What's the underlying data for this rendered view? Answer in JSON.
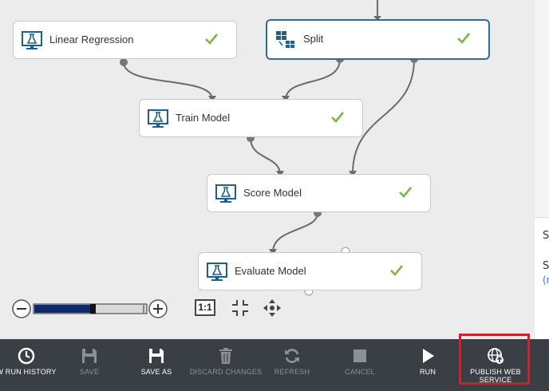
{
  "canvas": {
    "modules": [
      {
        "label": "Linear Regression",
        "type": "train-icon"
      },
      {
        "label": "Split",
        "type": "split-icon"
      },
      {
        "label": "Train Model",
        "type": "train-icon"
      },
      {
        "label": "Score Model",
        "type": "train-icon"
      },
      {
        "label": "Evaluate Model",
        "type": "train-icon"
      }
    ],
    "status": "completed"
  },
  "zoom": {
    "fit_label": "1:1"
  },
  "right_panel": {
    "text1": "S",
    "text2": "S",
    "link": "(r"
  },
  "toolbar": {
    "run_history": "W RUN HISTORY",
    "save": "SAVE",
    "save_as": "SAVE AS",
    "discard": "DISCARD CHANGES",
    "refresh": "REFRESH",
    "cancel": "CANCEL",
    "run": "RUN",
    "publish": "PUBLISH WEB SERVICE"
  },
  "colors": {
    "toolbar_bg": "#3a3f45",
    "accent": "#2a6f9a",
    "check": "#7ab648",
    "highlight": "#d0202a"
  }
}
